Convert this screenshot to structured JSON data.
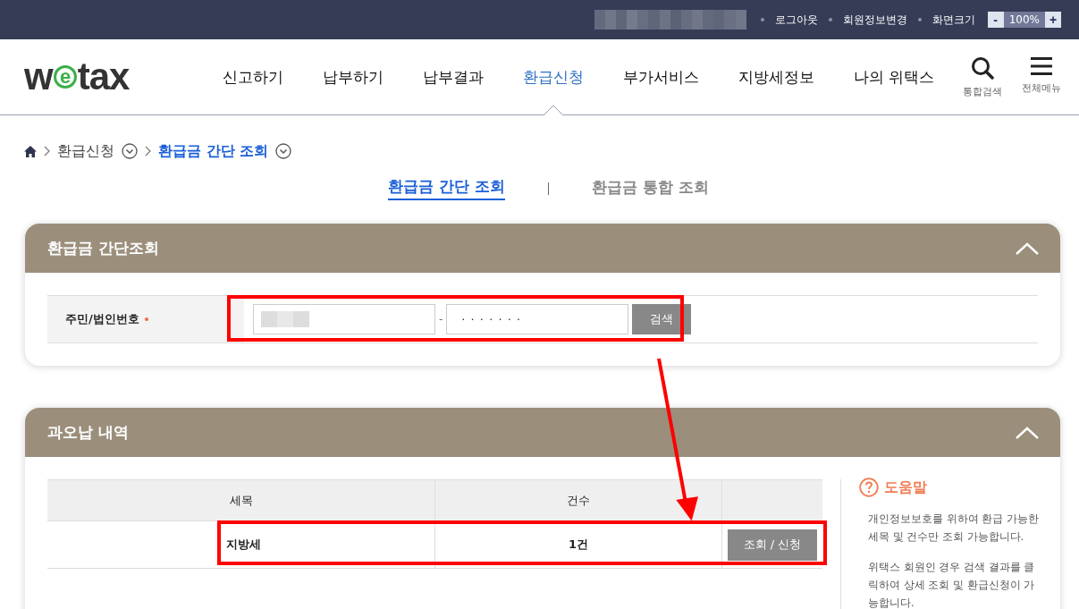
{
  "top_bar": {
    "links": [
      "로그아웃",
      "회원정보변경",
      "화면크기"
    ],
    "zoom": {
      "minus": "-",
      "value": "100%",
      "plus": "+"
    }
  },
  "logo": {
    "parts": [
      "w",
      "e",
      "tax"
    ]
  },
  "nav": [
    {
      "label": "신고하기",
      "selected": false
    },
    {
      "label": "납부하기",
      "selected": false
    },
    {
      "label": "납부결과",
      "selected": false
    },
    {
      "label": "환급신청",
      "selected": true
    },
    {
      "label": "부가서비스",
      "selected": false
    },
    {
      "label": "지방세정보",
      "selected": false
    },
    {
      "label": "나의 위택스",
      "selected": false
    }
  ],
  "tools": [
    {
      "kind": "search",
      "label": "통합검색"
    },
    {
      "kind": "menu",
      "label": "전체메뉴"
    }
  ],
  "breadcrumb": [
    {
      "label": "환급신청",
      "current": false
    },
    {
      "label": "환급금 간단 조회",
      "current": true
    }
  ],
  "tabs": [
    {
      "label": "환급금 간단 조회",
      "selected": true
    },
    {
      "label": "환급금 통합 조회",
      "selected": false
    }
  ],
  "search_card": {
    "title": "환급금 간단조회",
    "expanded": true,
    "field_label": "주민/법인번호",
    "required": true,
    "separator": "-",
    "second_value": "· · · · · · ·",
    "button": "검색"
  },
  "refund_card": {
    "title": "과오납 내역",
    "expanded": true,
    "columns": [
      "세목",
      "건수"
    ],
    "rows": [
      {
        "tax": "지방세",
        "count": "1건",
        "action": "조회 / 신청"
      }
    ],
    "help": {
      "title": "도움말",
      "items": [
        "개인정보보호를 위하여 환급 가능한 세목 및 건수만 조회 가능합니다.",
        "위택스 회원인 경우 검색 결과를 클릭하여 상세 조회 및 환급신청이 가능합니다."
      ]
    }
  }
}
